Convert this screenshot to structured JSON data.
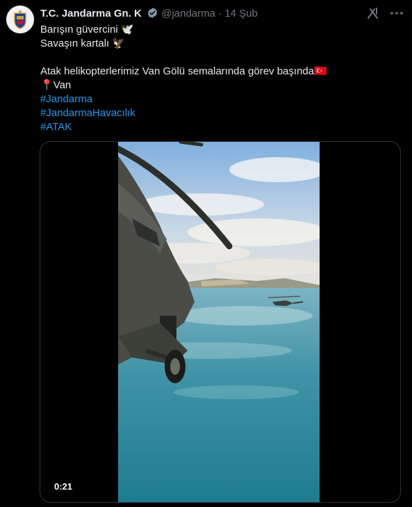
{
  "author": {
    "display_name": "T.C. Jandarma Gn. K",
    "handle": "@jandarma",
    "separator": "·",
    "date": "14 Şub"
  },
  "tweet": {
    "line1": "Barışın güvercini",
    "line1_emoji": "🕊️",
    "line2": "Savaşın kartalı",
    "line2_emoji": "🦅",
    "line3": "Atak helikopterlerimiz Van Gölü semalarında görev başında",
    "line3_emoji": "🇹🇷",
    "location_emoji": "📍",
    "location": "Van",
    "hashtags": [
      "#Jandarma",
      "#JandarmaHavacılık",
      "#ATAK"
    ]
  },
  "media": {
    "type": "video",
    "duration": "0:21"
  },
  "colors": {
    "background": "#000000",
    "text": "#e7e9ea",
    "muted": "#71767b",
    "link": "#1d9bf0",
    "verified_badge": "#829aab"
  },
  "icons": [
    "verified-badge-icon",
    "grok-icon",
    "more-options-icon"
  ]
}
